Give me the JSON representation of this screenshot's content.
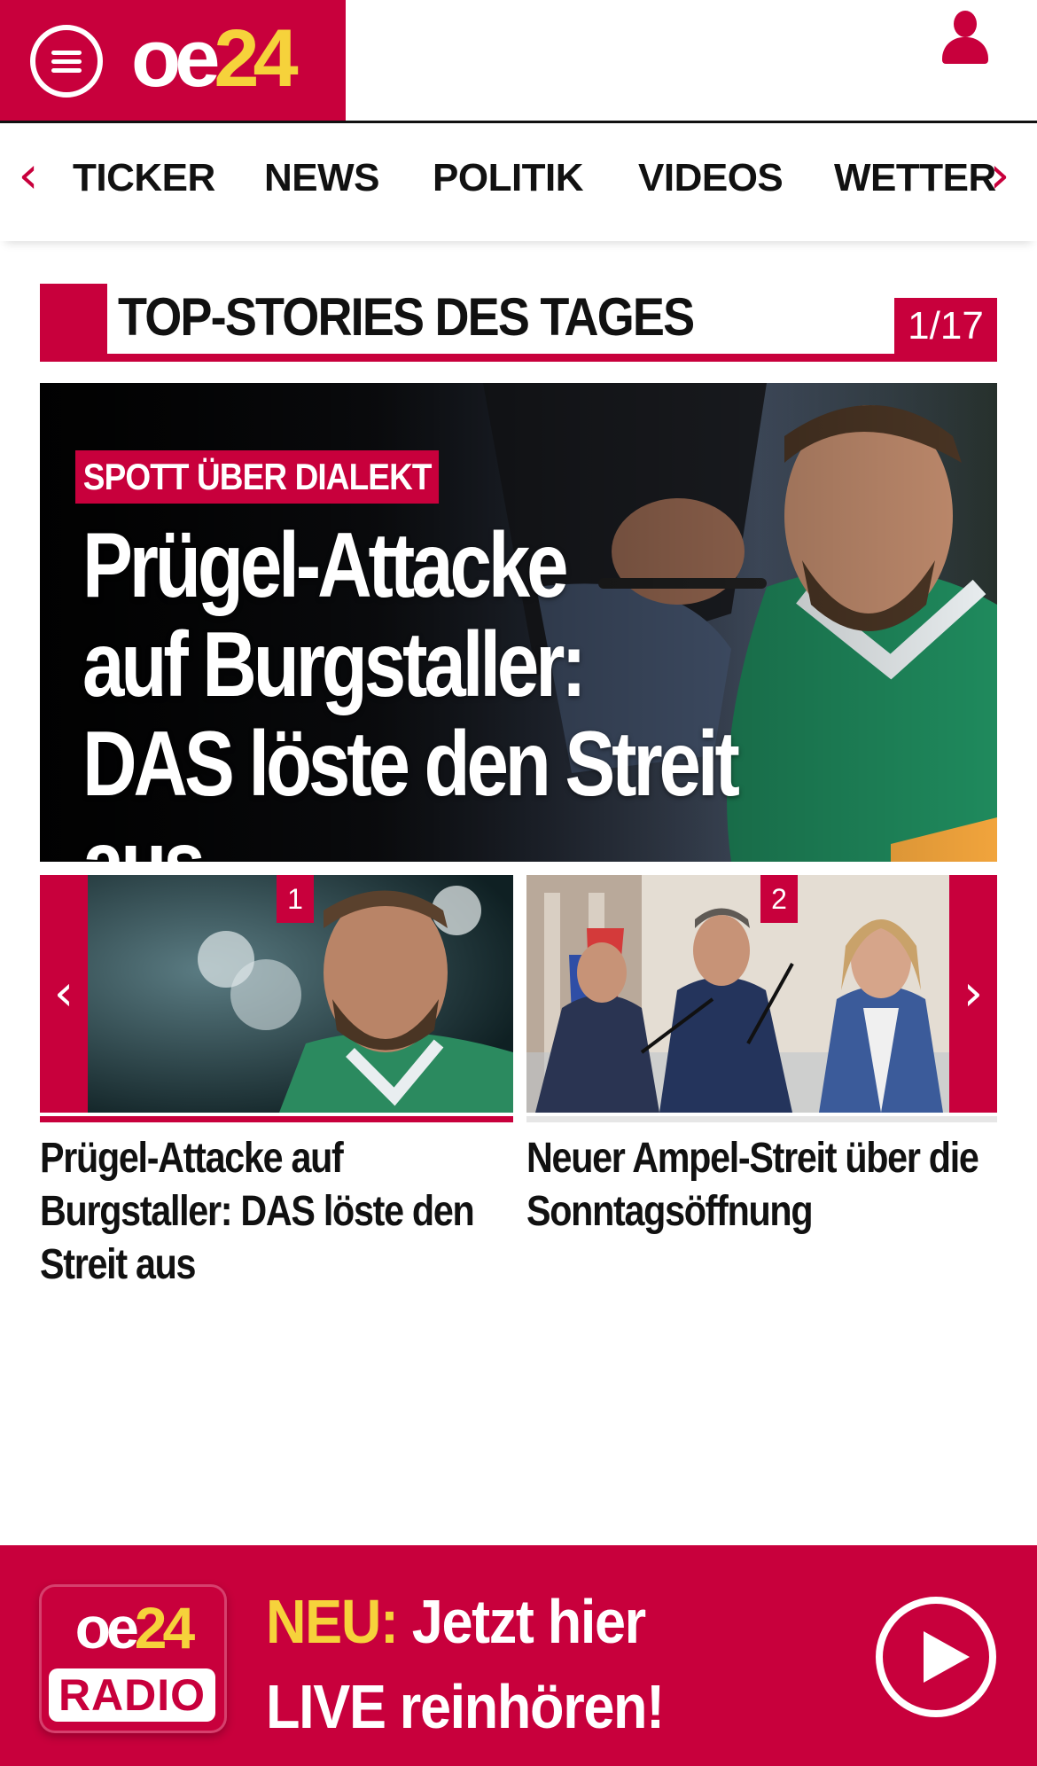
{
  "header": {
    "menu_icon": "hamburger-menu-icon",
    "logo": {
      "part1": "oe",
      "part2": "24"
    },
    "user_icon": "user-icon",
    "brand_color": "#c8003c",
    "accent_color": "#f6d23b"
  },
  "nav": {
    "prev_icon": "chevron-left-icon",
    "next_icon": "chevron-right-icon",
    "items": [
      "TICKER",
      "NEWS",
      "POLITIK",
      "VIDEOS",
      "WETTER"
    ]
  },
  "section": {
    "title": "TOP-STORIES DES TAGES",
    "counter": "1/17"
  },
  "hero": {
    "kicker": "SPOTT ÜBER DIALEKT",
    "headline_lines": [
      "Prügel-Attacke",
      "auf Burgstaller:",
      "DAS löste den Streit aus"
    ]
  },
  "carousel": {
    "prev_icon": "chevron-left-icon",
    "next_icon": "chevron-right-icon",
    "cards": [
      {
        "number": "1",
        "title": "Prügel-Attacke auf Burgstaller: DAS löste den Streit aus",
        "active": true
      },
      {
        "number": "2",
        "title": "Neuer Ampel-Streit über die Sonntagsöffnung",
        "active": false
      }
    ]
  },
  "radio": {
    "logo_top_part1": "oe",
    "logo_top_part2": "24",
    "logo_bottom": "RADIO",
    "line1_highlight": "NEU:",
    "line1_rest": " Jetzt hier",
    "line2": "LIVE reinhören!",
    "play_icon": "play-icon"
  }
}
